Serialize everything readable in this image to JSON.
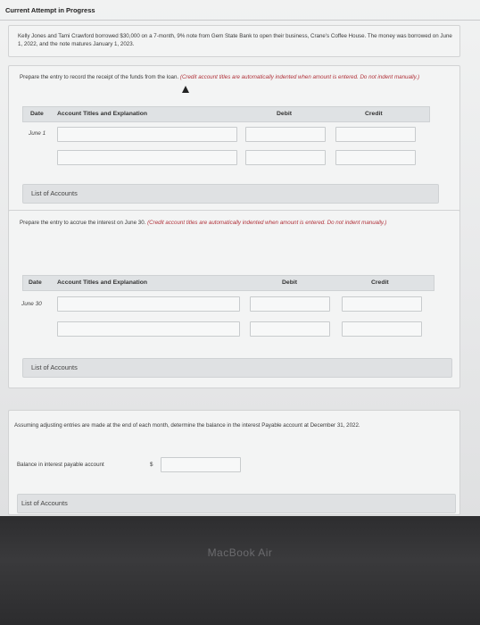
{
  "header": {
    "title": "Current Attempt in Progress"
  },
  "problem": {
    "text": "Kelly Jones and Tami Crawford borrowed $30,000 on a 7-month, 9% note from Gem State Bank to open their business, Crane's Coffee House. The money was borrowed on June 1, 2022, and the note matures January 1, 2023."
  },
  "part1": {
    "instruction": "Prepare the entry to record the receipt of the funds from the loan.",
    "note": "(Credit account titles are automatically indented when amount is entered. Do not indent manually.)",
    "col_date": "Date",
    "col_account": "Account Titles and Explanation",
    "col_debit": "Debit",
    "col_credit": "Credit",
    "date": "June 1",
    "list_label": "List of Accounts"
  },
  "part2": {
    "instruction": "Prepare the entry to accrue the interest on June 30.",
    "note": "(Credit account titles are automatically indented when amount is entered. Do not indent manually.)",
    "col_date": "Date",
    "col_account": "Account Titles and Explanation",
    "col_debit": "Debit",
    "col_credit": "Credit",
    "date": "June 30",
    "list_label": "List of Accounts"
  },
  "part3": {
    "instruction": "Assuming adjusting entries are made at the end of each month, determine the balance in the interest Payable account at December 31, 2022.",
    "balance_label": "Balance in interest payable account",
    "currency": "$",
    "list_label": "List of Accounts"
  },
  "footer": {
    "device_label": "MacBook Air"
  }
}
